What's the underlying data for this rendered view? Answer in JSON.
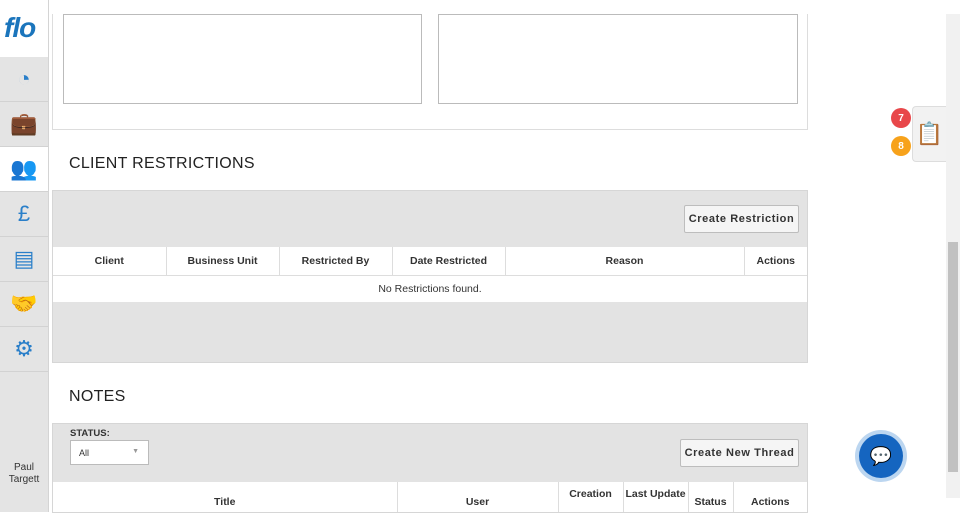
{
  "sidebar": {
    "logo": "flo",
    "items": [
      {
        "name": "dashboard",
        "icon": "◔"
      },
      {
        "name": "jobs",
        "icon": "💼"
      },
      {
        "name": "clients",
        "icon": "👥"
      },
      {
        "name": "finance",
        "icon": "£"
      },
      {
        "name": "documents",
        "icon": "▤"
      },
      {
        "name": "deals",
        "icon": "🤝"
      },
      {
        "name": "settings",
        "icon": "⚙"
      }
    ],
    "user": "Paul Targett"
  },
  "restrictions": {
    "title": "CLIENT RESTRICTIONS",
    "create_button": "Create Restriction",
    "columns": [
      "Client",
      "Business Unit",
      "Restricted By",
      "Date Restricted",
      "Reason",
      "Actions"
    ],
    "empty": "No Restrictions found."
  },
  "notes": {
    "title": "NOTES",
    "status_label": "STATUS:",
    "status_value": "All",
    "create_button": "Create New Thread",
    "columns": [
      "Title",
      "User",
      "Creation",
      "Last Update",
      "Status",
      "Actions"
    ]
  },
  "badges": {
    "red": "7",
    "orange": "8"
  },
  "colors": {
    "accent": "#2a7fc9",
    "badge_red": "#e8474a",
    "badge_orange": "#f7a21b",
    "chat": "#1565c0"
  }
}
